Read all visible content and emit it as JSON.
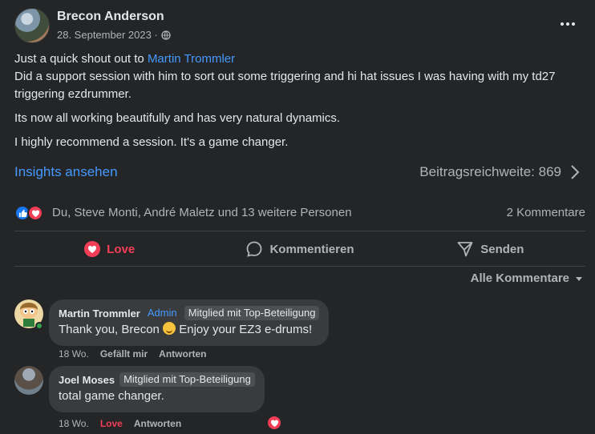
{
  "post": {
    "author": "Brecon Anderson",
    "date": "28. September 2023 ·",
    "paragraphs": {
      "line1_prefix": "Just a quick shout out to",
      "mention": "Martin Trommler",
      "line2": "Did a support session with him to sort out some triggering and hi hat issues I was having with my td27 triggering ezdrummer.",
      "p2": "Its now all working beautifully and has very natural dynamics.",
      "p3": "I highly recommend a session. It's a game changer."
    },
    "insights_link": "Insights ansehen",
    "reach": "Beitragsreichweite: 869",
    "reactions_text": "Du, Steve Monti, André Maletz und 13 weitere Personen",
    "comment_count": "2 Kommentare"
  },
  "actions": {
    "love": "Love",
    "comment": "Kommentieren",
    "send": "Senden"
  },
  "sort_label": "Alle Kommentare",
  "comments": [
    {
      "name": "Martin Trommler",
      "badge_admin": "Admin",
      "badge_top": "Mitglied mit Top-Beteiligung",
      "text_before": "Thank you, Brecon",
      "text_after": "Enjoy your EZ3 e-drums!",
      "time": "18 Wo.",
      "like": "Gefällt mir",
      "reply": "Antworten"
    },
    {
      "name": "Joel Moses",
      "badge_top": "Mitglied mit Top-Beteiligung",
      "text": "total game changer.",
      "time": "18 Wo.",
      "like": "Love",
      "reply": "Antworten"
    }
  ],
  "colors": {
    "background": "#242526",
    "link_blue": "#4599ff",
    "love_red": "#f33e58",
    "like_blue": "#1877f2"
  },
  "icons": [
    "globe-icon",
    "more-icon",
    "chevron-right-icon",
    "like-reaction-icon",
    "love-reaction-icon",
    "heart-icon",
    "comment-icon",
    "send-icon",
    "chevron-down-icon",
    "smile-emoji"
  ]
}
